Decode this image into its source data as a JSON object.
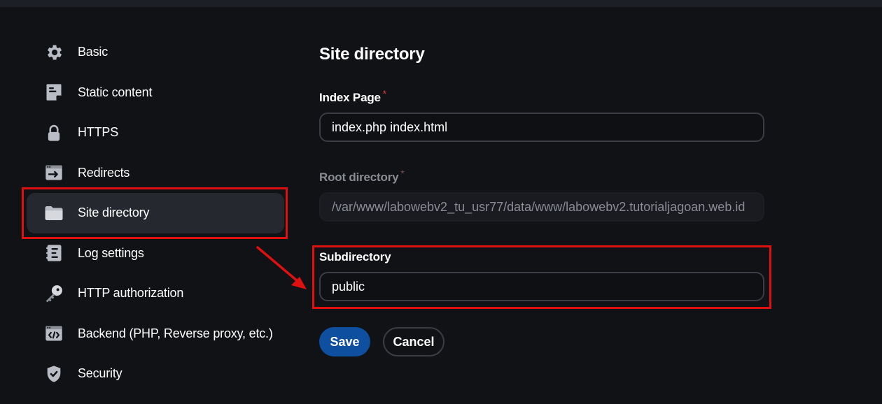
{
  "sidebar": {
    "items": [
      {
        "label": "Basic",
        "icon": "gear-icon"
      },
      {
        "label": "Static content",
        "icon": "document-icon"
      },
      {
        "label": "HTTPS",
        "icon": "lock-icon"
      },
      {
        "label": "Redirects",
        "icon": "redirect-icon"
      },
      {
        "label": "Site directory",
        "icon": "folder-icon",
        "active": true
      },
      {
        "label": "Log settings",
        "icon": "log-icon"
      },
      {
        "label": "HTTP authorization",
        "icon": "key-icon"
      },
      {
        "label": "Backend (PHP, Reverse proxy, etc.)",
        "icon": "code-window-icon"
      },
      {
        "label": "Security",
        "icon": "shield-check-icon"
      }
    ]
  },
  "main": {
    "title": "Site directory",
    "index_page": {
      "label": "Index Page",
      "required_mark": "*",
      "value": "index.php index.html"
    },
    "root_directory": {
      "label": "Root directory",
      "required_mark": "*",
      "value": "/var/www/labowebv2_tu_usr77/data/www/labowebv2.tutorialjagoan.web.id",
      "disabled": true
    },
    "subdirectory": {
      "label": "Subdirectory",
      "value": "public"
    },
    "buttons": {
      "save": "Save",
      "cancel": "Cancel"
    }
  },
  "colors": {
    "background": "#111216",
    "active_item": "#262830",
    "primary": "#0e4fa0",
    "annotation": "#e01010"
  }
}
